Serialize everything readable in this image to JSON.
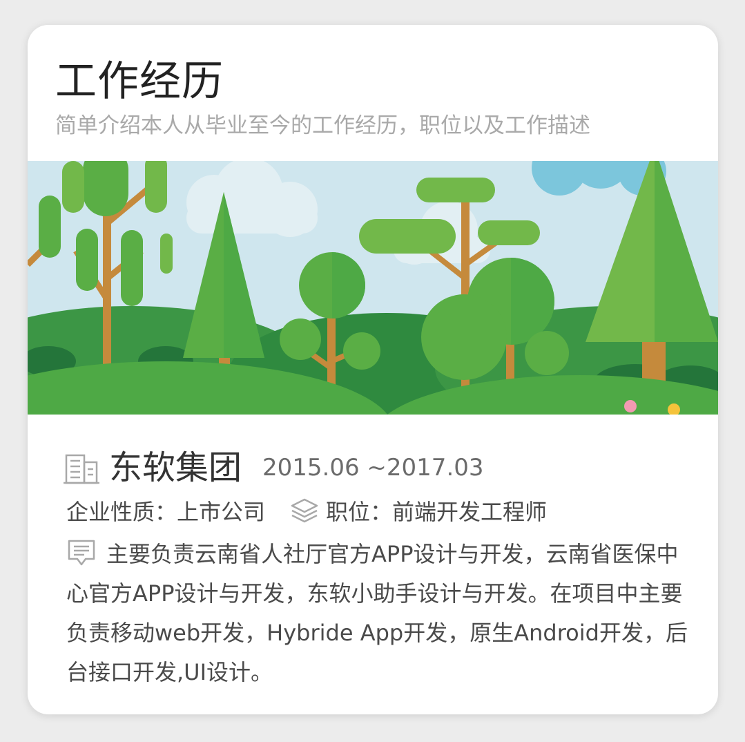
{
  "header": {
    "title": "工作经历",
    "subtitle": "简单介绍本人从毕业至今的工作经历，职位以及工作描述"
  },
  "banner": {
    "image": "forest-illustration",
    "colors": {
      "sky": "#cfe6ee",
      "cloud": "#e4f0f4",
      "light_green": "#72b84a",
      "mid_green": "#4ea945",
      "dark_green": "#2f8a3f",
      "trunk": "#c58a3c"
    }
  },
  "experience": {
    "company_icon": "building-icon",
    "company": "东软集团",
    "date_range": "2015.06 ~2017.03",
    "nature": "企业性质：上市公司",
    "position_icon": "layers-icon",
    "position": "职位：前端开发工程师",
    "description_icon": "comment-icon",
    "description": "主要负责云南省人社厅官方APP设计与开发，云南省医保中心官方APP设计与开发，东软小助手设计与开发。在项目中主要负责移动web开发，Hybride App开发，原生Android开发，后台接口开发,UI设计。"
  },
  "colors": {
    "title": "#222222",
    "subtitle": "#a9a9a9",
    "body_text": "#4a4a4a",
    "icon": "#9a9a9a"
  }
}
